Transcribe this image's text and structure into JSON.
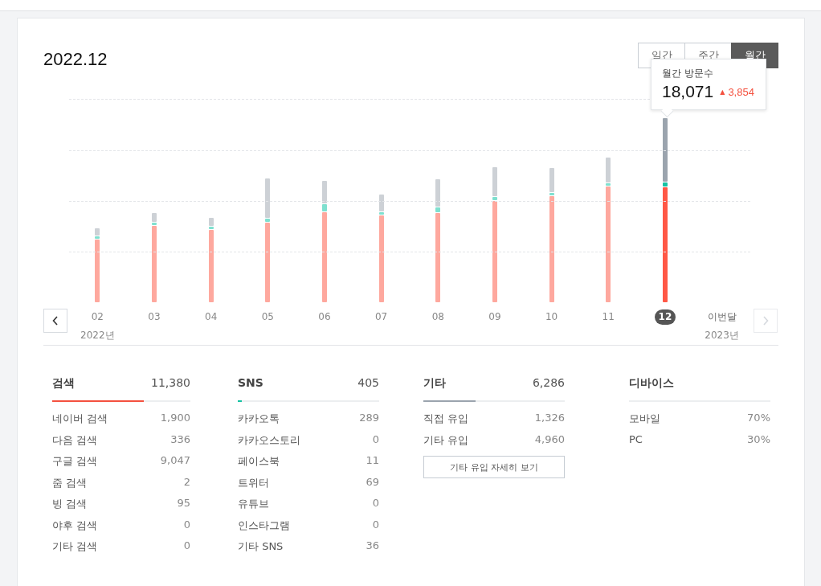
{
  "title": "2022.12",
  "period_tabs": [
    {
      "label": "일간",
      "selected": false
    },
    {
      "label": "주간",
      "selected": false
    },
    {
      "label": "월간",
      "selected": true
    }
  ],
  "tooltip": {
    "title": "월간 방문수",
    "value": "18,071",
    "trend": "▲",
    "change": "3,854"
  },
  "axis": [
    {
      "kind": "month",
      "label": "02",
      "year": "2022년",
      "selected": false
    },
    {
      "kind": "month",
      "label": "03",
      "selected": false
    },
    {
      "kind": "month",
      "label": "04",
      "selected": false
    },
    {
      "kind": "month",
      "label": "05",
      "selected": false
    },
    {
      "kind": "month",
      "label": "06",
      "selected": false
    },
    {
      "kind": "month",
      "label": "07",
      "selected": false
    },
    {
      "kind": "month",
      "label": "08",
      "selected": false
    },
    {
      "kind": "month",
      "label": "09",
      "selected": false
    },
    {
      "kind": "month",
      "label": "10",
      "selected": false
    },
    {
      "kind": "month",
      "label": "11",
      "selected": false
    },
    {
      "kind": "month",
      "label": "12",
      "selected": true
    },
    {
      "kind": "current",
      "label": "이번달",
      "year": "2023년",
      "selected": false
    }
  ],
  "next_disabled": true,
  "sources": [
    {
      "name": "검색",
      "total": "11,380",
      "level": 0.66,
      "color": "#f4513f",
      "items": [
        {
          "label": "네이버 검색",
          "value": "1,900"
        },
        {
          "label": "다음 검색",
          "value": "336"
        },
        {
          "label": "구글 검색",
          "value": "9,047"
        },
        {
          "label": "줌 검색",
          "value": "2"
        },
        {
          "label": "빙 검색",
          "value": "95"
        },
        {
          "label": "야후 검색",
          "value": "0"
        },
        {
          "label": "기타 검색",
          "value": "0"
        }
      ]
    },
    {
      "name": "SNS",
      "total": "405",
      "level": 0.03,
      "color": "#15c2a3",
      "items": [
        {
          "label": "카카오톡",
          "value": "289"
        },
        {
          "label": "카카오스토리",
          "value": "0"
        },
        {
          "label": "페이스북",
          "value": "11"
        },
        {
          "label": "트위터",
          "value": "69"
        },
        {
          "label": "유튜브",
          "value": "0"
        },
        {
          "label": "인스타그램",
          "value": "0"
        },
        {
          "label": "기타 SNS",
          "value": "36"
        }
      ]
    },
    {
      "name": "기타",
      "total": "6,286",
      "level": 0.37,
      "color": "#9ba4ae",
      "items": [
        {
          "label": "직접 유입",
          "value": "1,326"
        },
        {
          "label": "기타 유입",
          "value": "4,960"
        }
      ],
      "button": "기타 유입 자세히 보기"
    },
    {
      "name": "디바이스",
      "items": [
        {
          "label": "모바일",
          "value": "70%"
        },
        {
          "label": "PC",
          "value": "30%"
        }
      ]
    }
  ]
}
